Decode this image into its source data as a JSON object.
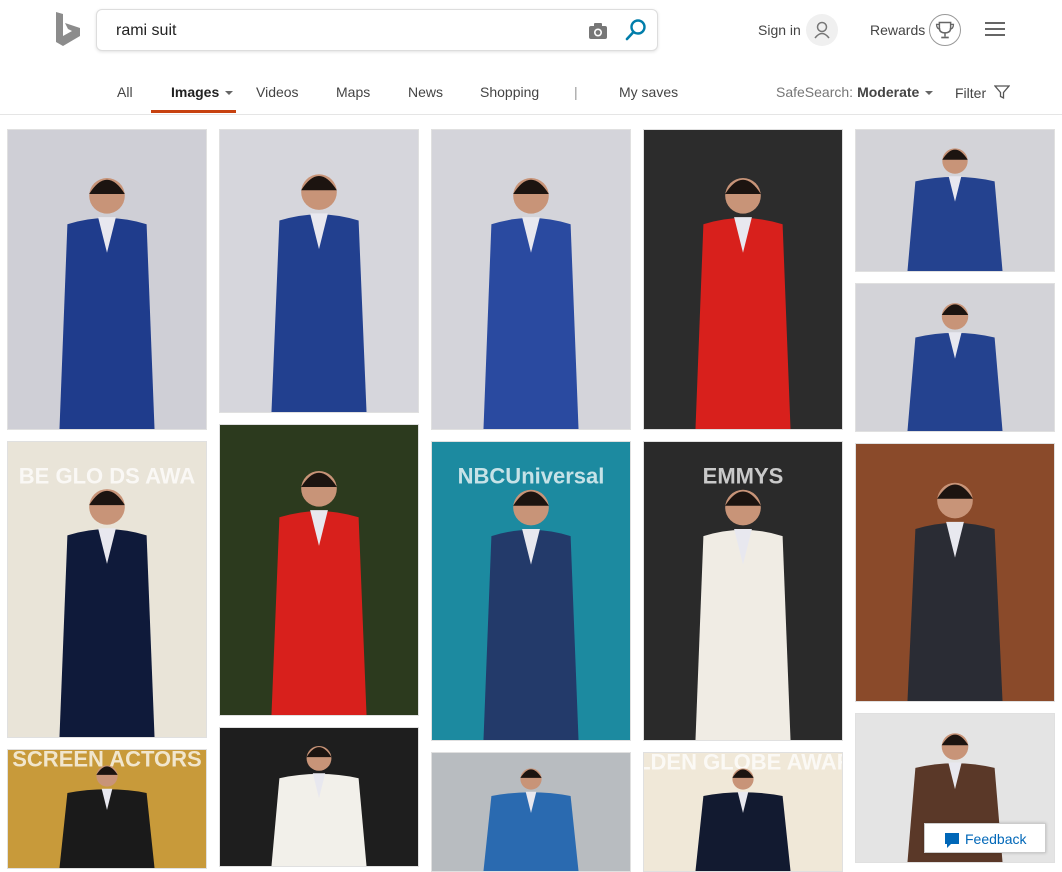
{
  "search": {
    "query": "rami suit"
  },
  "header": {
    "signin_label": "Sign in",
    "rewards_label": "Rewards"
  },
  "nav": {
    "all": "All",
    "images": "Images",
    "videos": "Videos",
    "maps": "Maps",
    "news": "News",
    "shopping": "Shopping",
    "separator": "|",
    "my_saves": "My saves",
    "safesearch_label": "SafeSearch:",
    "safesearch_value": "Moderate",
    "filter_label": "Filter"
  },
  "images": [
    {
      "name": "image-result-1",
      "suit_color": "#1f3c8c",
      "bg": "#cfcfd6"
    },
    {
      "name": "image-result-2",
      "suit_color": "#22408f",
      "bg": "#d6d6dc"
    },
    {
      "name": "image-result-3",
      "suit_color": "#2a4aa0",
      "bg": "#d4d4da"
    },
    {
      "name": "image-result-4",
      "suit_color": "#d8201c",
      "bg": "#2c2c2c"
    },
    {
      "name": "image-result-5",
      "suit_color": "#24428f",
      "bg": "#d3d3d8"
    },
    {
      "name": "image-result-6",
      "suit_color": "#24428f",
      "bg": "#d3d3d8"
    },
    {
      "name": "image-result-7",
      "suit_color": "#0f1a3a",
      "bg": "#e9e4d8",
      "overlay": "BE GLO DS AWA"
    },
    {
      "name": "image-result-8",
      "suit_color": "#d8201c",
      "bg": "#2c3a1e"
    },
    {
      "name": "image-result-9",
      "suit_color": "#233a6a",
      "bg": "#1c8aa0",
      "overlay": "NBCUniversal"
    },
    {
      "name": "image-result-10",
      "suit_color": "#f0ece4",
      "bg": "#2a2a2a",
      "overlay": "EMMYS"
    },
    {
      "name": "image-result-11",
      "suit_color": "#2a2c34",
      "bg": "#8a4a2a"
    },
    {
      "name": "image-result-12",
      "suit_color": "#1a1a1a",
      "bg": "#c89a3a",
      "overlay": "SCREEN ACTORS"
    },
    {
      "name": "image-result-13",
      "suit_color": "#f2f0ea",
      "bg": "#1e1e1e"
    },
    {
      "name": "image-result-14",
      "suit_color": "#2a6ab0",
      "bg": "#b8bcc0"
    },
    {
      "name": "image-result-15",
      "suit_color": "#121a30",
      "bg": "#f0e8d8",
      "overlay": "GOLDEN GLOBE AWARDS"
    },
    {
      "name": "image-result-16",
      "suit_color": "#5a3828",
      "bg": "#e4e4e4"
    }
  ],
  "feedback": {
    "label": "Feedback"
  },
  "colors": {
    "accent": "#c7410f",
    "link": "#0067b8",
    "search_icon": "#007daa"
  }
}
